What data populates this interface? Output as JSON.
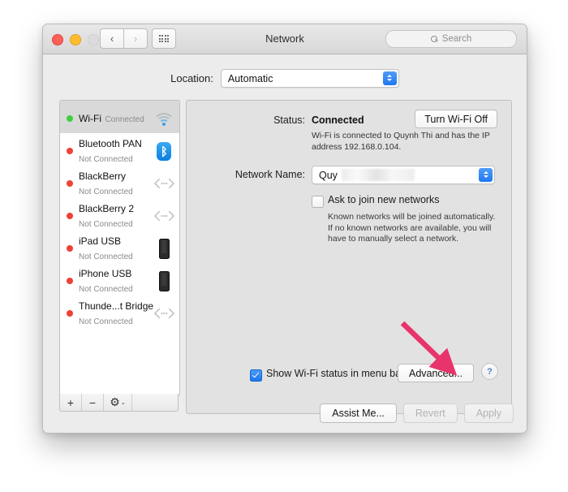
{
  "window": {
    "title": "Network",
    "traffic_lights": [
      "close",
      "minimize",
      "zoom"
    ],
    "nav": {
      "back": "‹",
      "forward": "›"
    },
    "grid_button": "show-all-icon",
    "search": {
      "placeholder": "Search",
      "icon": "search-icon"
    }
  },
  "location": {
    "label": "Location:",
    "value": "Automatic"
  },
  "sidebar": {
    "services": [
      {
        "name": "Wi-Fi",
        "status": "Connected",
        "dot": "green",
        "icon": "wifi-icon",
        "selected": true
      },
      {
        "name": "Bluetooth PAN",
        "status": "Not Connected",
        "dot": "red",
        "icon": "bluetooth-icon",
        "selected": false
      },
      {
        "name": "BlackBerry",
        "status": "Not Connected",
        "dot": "red",
        "icon": "thunderbolt-icon",
        "selected": false
      },
      {
        "name": "BlackBerry 2",
        "status": "Not Connected",
        "dot": "red",
        "icon": "thunderbolt-icon",
        "selected": false
      },
      {
        "name": "iPad USB",
        "status": "Not Connected",
        "dot": "red",
        "icon": "phone-icon",
        "selected": false
      },
      {
        "name": "iPhone USB",
        "status": "Not Connected",
        "dot": "red",
        "icon": "phone-icon",
        "selected": false
      },
      {
        "name": "Thunde...t Bridge",
        "status": "Not Connected",
        "dot": "red",
        "icon": "thunderbolt-icon",
        "selected": false
      }
    ],
    "toolbar": {
      "add": "+",
      "remove": "−",
      "gear": "⚙",
      "gear_chevron": "⌄"
    }
  },
  "detail": {
    "status_label": "Status:",
    "status_value": "Connected",
    "turn_wifi_off_label": "Turn Wi-Fi Off",
    "status_description": "Wi-Fi is connected to Quynh Thi and has the IP address 192.168.0.104.",
    "network_name_label": "Network Name:",
    "network_name_value": "Quy",
    "ask_to_join_label": "Ask to join new networks",
    "ask_to_join_checked": false,
    "ask_to_join_description": "Known networks will be joined automatically. If no known networks are available, you will have to manually select a network.",
    "show_status_label": "Show Wi-Fi status in menu bar",
    "show_status_checked": true,
    "advanced_label": "Advanced...",
    "help_label": "?"
  },
  "footer": {
    "assist_me": "Assist Me...",
    "revert": "Revert",
    "apply": "Apply"
  },
  "annotation": {
    "type": "arrow",
    "color": "#E8336B",
    "points_to": "Advanced..."
  },
  "colors": {
    "accent_blue": "#1f78ef",
    "connected_green": "#3fd03f",
    "disconnected_red": "#ef4136",
    "annotation_pink": "#E8336B",
    "window_bg": "#ececec",
    "detail_bg": "#e2e2e2"
  }
}
